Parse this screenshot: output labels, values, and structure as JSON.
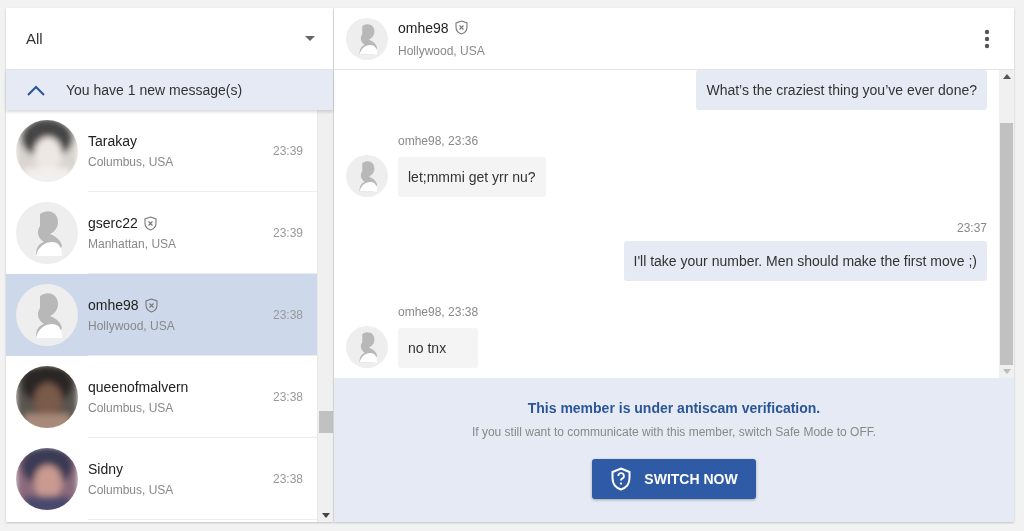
{
  "filter": {
    "value": "All"
  },
  "notice": {
    "text": "You have 1 new message(s)",
    "expanded": true
  },
  "contacts": [
    {
      "name": "Tarakay",
      "location": "Columbus, USA",
      "time": "23:39",
      "flagged": false,
      "selected": false
    },
    {
      "name": "gserc22",
      "location": "Manhattan, USA",
      "time": "23:39",
      "kind": "default",
      "flagged": true,
      "selected": false
    },
    {
      "name": "omhe98",
      "location": "Hollywood, USA",
      "time": "23:38",
      "kind": "default",
      "flagged": true,
      "selected": true
    },
    {
      "name": "queenofmalvern",
      "location": "Columbus, USA",
      "time": "23:38",
      "flagged": false,
      "selected": false
    },
    {
      "name": "Sidny",
      "location": "Columbus, USA",
      "time": "23:38",
      "flagged": false,
      "selected": false
    }
  ],
  "chat": {
    "name": "omhe98",
    "location": "Hollywood, USA",
    "flagged": true,
    "messages": [
      {
        "kind": "outgoing",
        "text": "What’s the craziest thing you’ve ever done?"
      },
      {
        "kind": "incoming",
        "meta": "omhe98,  23:36",
        "text": "let;mmmi get yrr nu?"
      },
      {
        "kind": "outgoing",
        "meta": "23:37",
        "text": "I'll take your number. Men should make the first move ;)"
      },
      {
        "kind": "incoming",
        "meta": "omhe98,  23:38",
        "text": "no tnx"
      }
    ]
  },
  "safe_mode": {
    "title": "This member is under antiscam verification.",
    "text": "If you still want to communicate with this member, switch Safe Mode to OFF.",
    "button": "SWITCH NOW"
  }
}
